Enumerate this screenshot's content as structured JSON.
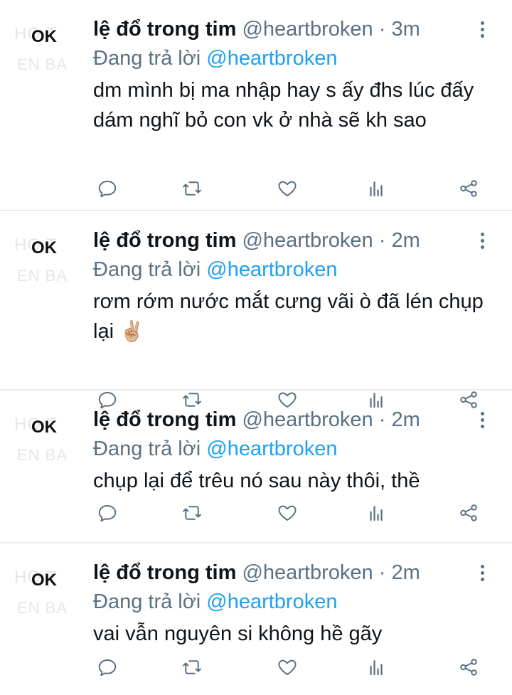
{
  "tweets": [
    {
      "avatar_text": "OK",
      "avatar_watermark_1": "HO T",
      "avatar_watermark_2": "EN BA",
      "name": "lệ đổ trong tim",
      "handle": "@heartbroken",
      "separator": "·",
      "time": "3m",
      "replying_prefix": "Đang trả lời",
      "replying_handle": "@heartbroken",
      "text": "dm mình bị ma nhập hay s ấy đhs lúc đấy dám nghĩ bỏ con vk ở nhà sẽ kh sao",
      "emoji": ""
    },
    {
      "avatar_text": "OK",
      "avatar_watermark_1": "HO T",
      "avatar_watermark_2": "EN BA",
      "name": "lệ đổ trong tim",
      "handle": "@heartbroken",
      "separator": "·",
      "time": "2m",
      "replying_prefix": "Đang trả lời",
      "replying_handle": "@heartbroken",
      "text": "rơm rớm nước mắt cưng vãi ò đã lén chụp lại",
      "emoji": "✌🏼"
    },
    {
      "avatar_text": "OK",
      "avatar_watermark_1": "HO T",
      "avatar_watermark_2": "EN BA",
      "name": "lệ đổ trong tim",
      "handle": "@heartbroken",
      "separator": "·",
      "time": "2m",
      "replying_prefix": "Đang trả lời",
      "replying_handle": "@heartbroken",
      "text": "chụp lại để trêu nó sau này thôi, thề",
      "emoji": ""
    },
    {
      "avatar_text": "OK",
      "avatar_watermark_1": "HO T",
      "avatar_watermark_2": "EN BA",
      "name": "lệ đổ trong tim",
      "handle": "@heartbroken",
      "separator": "·",
      "time": "2m",
      "replying_prefix": "Đang trả lời",
      "replying_handle": "@heartbroken",
      "text": "vai vẫn nguyên si không hề gãy",
      "emoji": ""
    }
  ],
  "icons": {
    "reply": "reply-icon",
    "retweet": "retweet-icon",
    "like": "heart-icon",
    "stats": "stats-icon",
    "share": "share-icon",
    "more": "more-vertical-icon"
  },
  "colors": {
    "text": "#0f1419",
    "secondary": "#5b7083",
    "link": "#1da1f2",
    "divider": "#e6ecf0"
  }
}
